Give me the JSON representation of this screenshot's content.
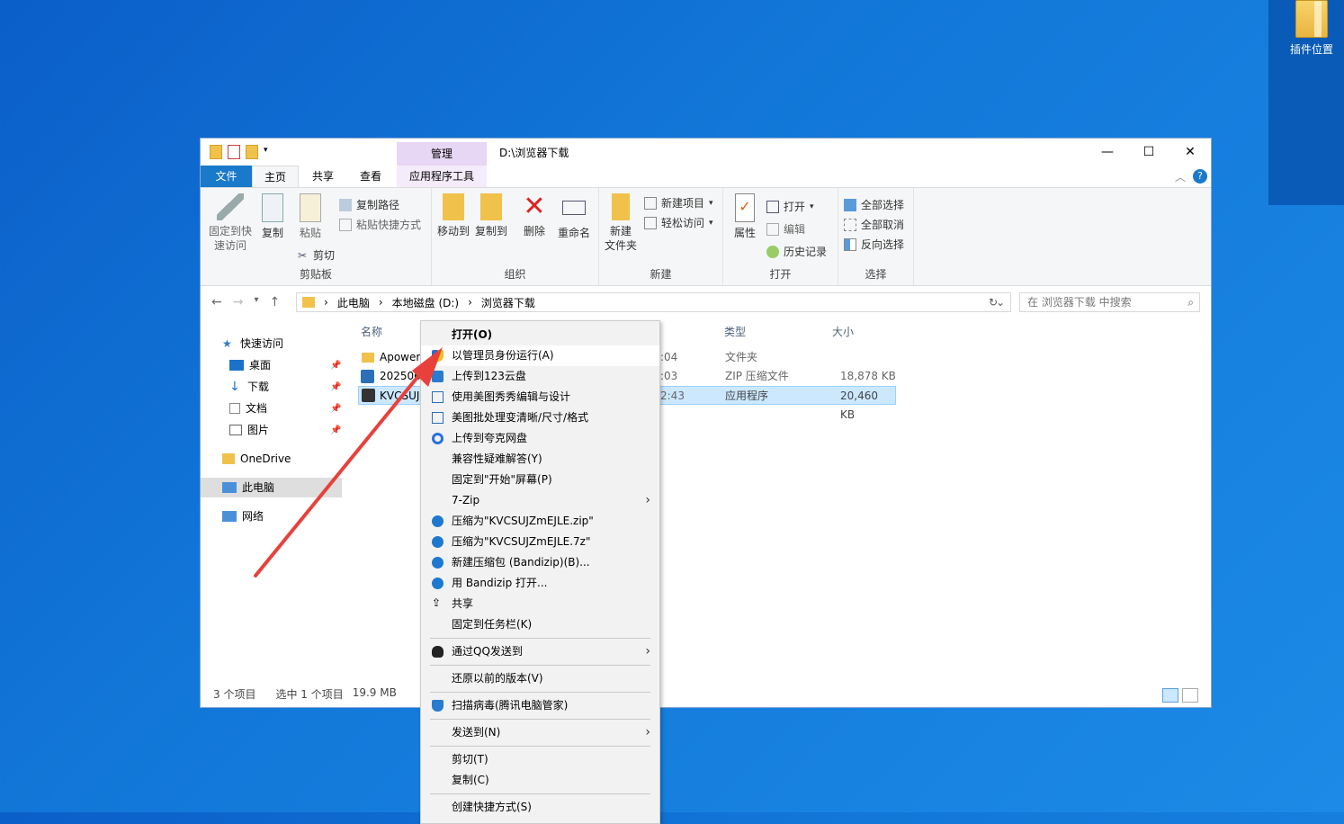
{
  "desktop": {
    "icon_label": "插件位置"
  },
  "window": {
    "path_title": "D:\\浏览器下载",
    "context_tab": "管理",
    "controls": {
      "minimize": "—",
      "maximize": "☐",
      "close": "✕"
    },
    "tabs": {
      "file": "文件",
      "home": "主页",
      "share": "共享",
      "view": "查看",
      "apptools": "应用程序工具"
    },
    "ribbon": {
      "clipboard": {
        "label": "剪贴板",
        "pin": "固定到快\n速访问",
        "copy": "复制",
        "paste": "粘贴",
        "copy_path": "复制路径",
        "paste_shortcut": "粘贴快捷方式",
        "cut": "剪切"
      },
      "organize": {
        "label": "组织",
        "move_to": "移动到",
        "copy_to": "复制到",
        "delete": "删除",
        "rename": "重命名"
      },
      "new": {
        "label": "新建",
        "new_folder": "新建\n文件夹",
        "new_item": "新建项目",
        "easy_access": "轻松访问"
      },
      "open": {
        "label": "打开",
        "properties": "属性",
        "open": "打开",
        "edit": "编辑",
        "history": "历史记录"
      },
      "select": {
        "label": "选择",
        "select_all": "全部选择",
        "select_none": "全部取消",
        "invert": "反向选择"
      }
    },
    "address": {
      "crumbs": [
        "此电脑",
        "本地磁盘 (D:)",
        "浏览器下载"
      ],
      "search_placeholder": "在 浏览器下载 中搜索"
    },
    "nav_pane": {
      "quick_access": "快速访问",
      "desktop": "桌面",
      "downloads": "下载",
      "documents": "文档",
      "pictures": "图片",
      "onedrive": "OneDrive",
      "this_pc": "此电脑",
      "network": "网络"
    },
    "columns": {
      "name": "名称",
      "type": "类型",
      "size": "大小"
    },
    "files": [
      {
        "name": "Apower",
        "date": ":04",
        "type": "文件夹",
        "size": ""
      },
      {
        "name": "2025062",
        "date": ":03",
        "type": "ZIP 压缩文件",
        "size": "18,878 KB"
      },
      {
        "name": "KVCSUJ",
        "date": "2:43",
        "type": "应用程序",
        "size": "20,460 KB"
      }
    ],
    "status": {
      "count": "3 个项目",
      "selected": "选中 1 个项目",
      "size": "19.9 MB"
    }
  },
  "context_menu": [
    {
      "label": "打开(O)"
    },
    {
      "label": "以管理员身份运行(A)"
    },
    {
      "label": "上传到123云盘"
    },
    {
      "label": "使用美图秀秀编辑与设计"
    },
    {
      "label": "美图批处理变清晰/尺寸/格式"
    },
    {
      "label": "上传到夸克网盘"
    },
    {
      "label": "兼容性疑难解答(Y)"
    },
    {
      "label": "固定到\"开始\"屏幕(P)"
    },
    {
      "label": "7-Zip"
    },
    {
      "label": "压缩为\"KVCSUJZmEJLE.zip\""
    },
    {
      "label": "压缩为\"KVCSUJZmEJLE.7z\""
    },
    {
      "label": "新建压缩包 (Bandizip)(B)..."
    },
    {
      "label": "用 Bandizip 打开..."
    },
    {
      "label": "共享"
    },
    {
      "label": "固定到任务栏(K)"
    },
    {
      "label": "通过QQ发送到"
    },
    {
      "label": "还原以前的版本(V)"
    },
    {
      "label": "扫描病毒(腾讯电脑管家)"
    },
    {
      "label": "发送到(N)"
    },
    {
      "label": "剪切(T)"
    },
    {
      "label": "复制(C)"
    },
    {
      "label": "创建快捷方式(S)"
    }
  ],
  "colors": {
    "accent": "#1979ca",
    "selection": "#cce8ff",
    "annotation_arrow": "#e8413c"
  }
}
